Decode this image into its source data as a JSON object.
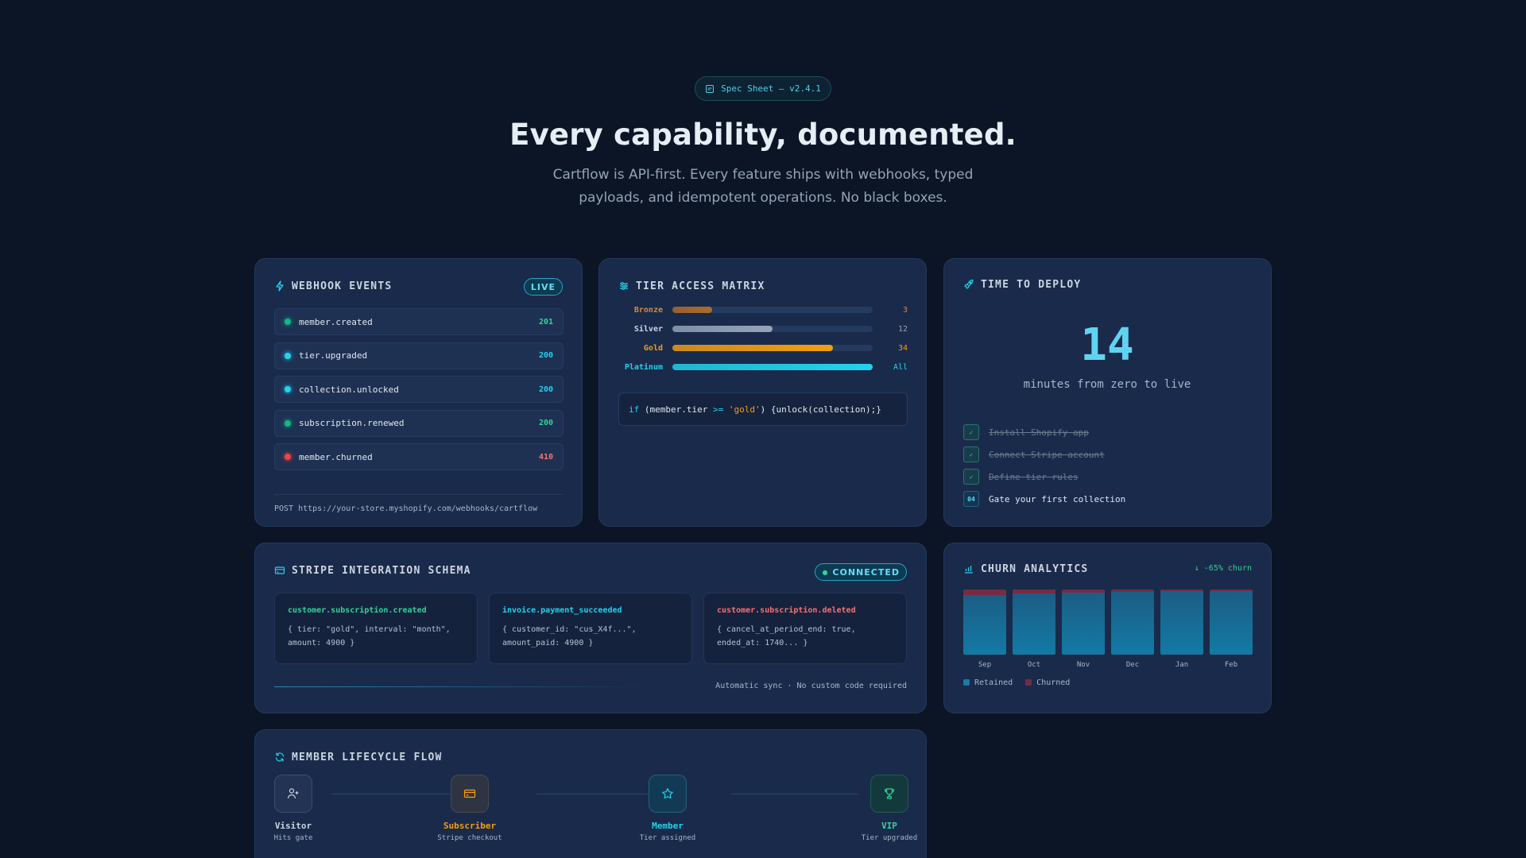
{
  "header": {
    "pill": "Spec Sheet — v2.4.1",
    "title": "Every capability, documented.",
    "subtitle": "Cartflow is API-first. Every feature ships with webhooks, typed payloads, and idempotent operations. No black boxes."
  },
  "webhook": {
    "title": "WEBHOOK EVENTS",
    "badge": "LIVE",
    "events": [
      {
        "name": "member.created",
        "code": "201",
        "color": "#10b981",
        "code_color": "#34d399"
      },
      {
        "name": "tier.upgraded",
        "code": "200",
        "color": "#22d3ee",
        "code_color": "#22d3ee"
      },
      {
        "name": "collection.unlocked",
        "code": "200",
        "color": "#22d3ee",
        "code_color": "#22d3ee"
      },
      {
        "name": "subscription.renewed",
        "code": "200",
        "color": "#10b981",
        "code_color": "#34d399"
      },
      {
        "name": "member.churned",
        "code": "410",
        "color": "#ef4444",
        "code_color": "#f87171"
      }
    ],
    "endpoint": "POST https://your-store.myshopify.com/webhooks/cartflow"
  },
  "tier": {
    "title": "TIER ACCESS MATRIX",
    "tiers": [
      {
        "label": "Bronze",
        "value": "3",
        "fill": 0.2,
        "color": "#d68a3c",
        "track_color": "#b06a2a"
      },
      {
        "label": "Silver",
        "value": "12",
        "fill": 0.5,
        "color": "#cbd5e1",
        "track_color": "#94a3b8"
      },
      {
        "label": "Gold",
        "value": "34",
        "fill": 0.8,
        "color": "#f59e0b",
        "track_color": "#f59e0b"
      },
      {
        "label": "Platinum",
        "value": "All",
        "fill": 1.0,
        "color": "#22d3ee",
        "track_color": "#22d3ee"
      }
    ],
    "code": {
      "kw": "if",
      "p1": " (member.tier ",
      "op": ">=",
      "p2": " ",
      "str": "'gold'",
      "p3": ") {unlock(collection);}"
    }
  },
  "deploy": {
    "title": "TIME TO DEPLOY",
    "number": "14",
    "caption": "minutes from zero to live",
    "steps": [
      {
        "text": "Install Shopify app",
        "done": true,
        "mark": "✓"
      },
      {
        "text": "Connect Stripe account",
        "done": true,
        "mark": "✓"
      },
      {
        "text": "Define tier rules",
        "done": true,
        "mark": "✓"
      },
      {
        "text": "Gate your first collection",
        "done": false,
        "mark": "04"
      }
    ]
  },
  "stripe": {
    "title": "STRIPE INTEGRATION SCHEMA",
    "badge": "CONNECTED",
    "events": [
      {
        "name": "customer.subscription.created",
        "color": "#34d399",
        "body": "{ tier: \"gold\", interval: \"month\", amount: 4900 }"
      },
      {
        "name": "invoice.payment_succeeded",
        "color": "#22d3ee",
        "body": "{ customer_id: \"cus_X4f...\", amount_paid: 4900 }"
      },
      {
        "name": "customer.subscription.deleted",
        "color": "#f87171",
        "body": "{ cancel_at_period_end: true, ended_at: 1740... }"
      }
    ],
    "footer": "Automatic sync · No custom code required"
  },
  "churn": {
    "title": "CHURN ANALYTICS",
    "stat": "↓ -65% churn",
    "legend": {
      "retained": "Retained",
      "churned": "Churned"
    },
    "colors": {
      "retained": "#1a7aa8",
      "churned": "#7a2a43"
    },
    "chart_data": {
      "type": "bar",
      "categories": [
        "Sep",
        "Oct",
        "Nov",
        "Dec",
        "Jan",
        "Feb"
      ],
      "series": [
        {
          "name": "Retained",
          "values": [
            92,
            94,
            95,
            96,
            97,
            97.5
          ]
        },
        {
          "name": "Churned",
          "values": [
            8,
            6,
            5,
            4,
            3,
            2.5
          ]
        }
      ],
      "ylim": [
        0,
        100
      ],
      "stacked": true,
      "legend": "bottom-left"
    }
  },
  "lifecycle": {
    "title": "MEMBER LIFECYCLE FLOW",
    "nodes": [
      {
        "name": "Visitor",
        "sub": "Hits gate",
        "icon": "user-plus-icon",
        "color": "#cbd5e1"
      },
      {
        "name": "Subscriber",
        "sub": "Stripe checkout",
        "icon": "credit-card-icon",
        "color": "#f59e0b"
      },
      {
        "name": "Member",
        "sub": "Tier assigned",
        "icon": "star-icon",
        "color": "#22d3ee"
      },
      {
        "name": "VIP",
        "sub": "Tier upgraded",
        "icon": "trophy-icon",
        "color": "#34d399"
      }
    ]
  }
}
